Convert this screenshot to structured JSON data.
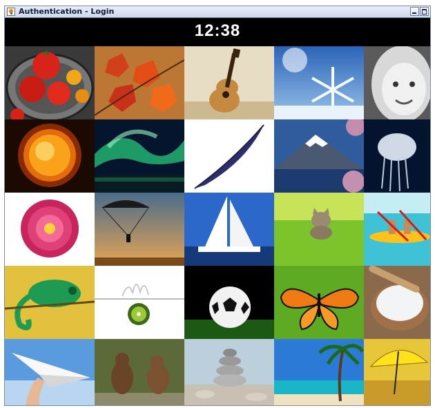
{
  "window": {
    "title": "Authentication - Login",
    "controls": [
      "minimize",
      "maximize"
    ]
  },
  "timer": "12:38",
  "picture_grid": [
    [
      "tomatoes",
      "autumn-leaves",
      "acoustic-guitar",
      "snowflake",
      "smiling-girl"
    ],
    [
      "sun",
      "northern-lights",
      "feather",
      "mount-fuji",
      "jellyfish"
    ],
    [
      "dahlia-flower",
      "parachute",
      "sailboat",
      "kitten",
      "kayakers"
    ],
    [
      "chameleon",
      "kiwi-splash",
      "soccer-ball",
      "butterfly",
      "salt-bowl"
    ],
    [
      "paper-airplane",
      "bear-cubs",
      "stone-stack",
      "palm-beach",
      "yellow-umbrella"
    ]
  ]
}
